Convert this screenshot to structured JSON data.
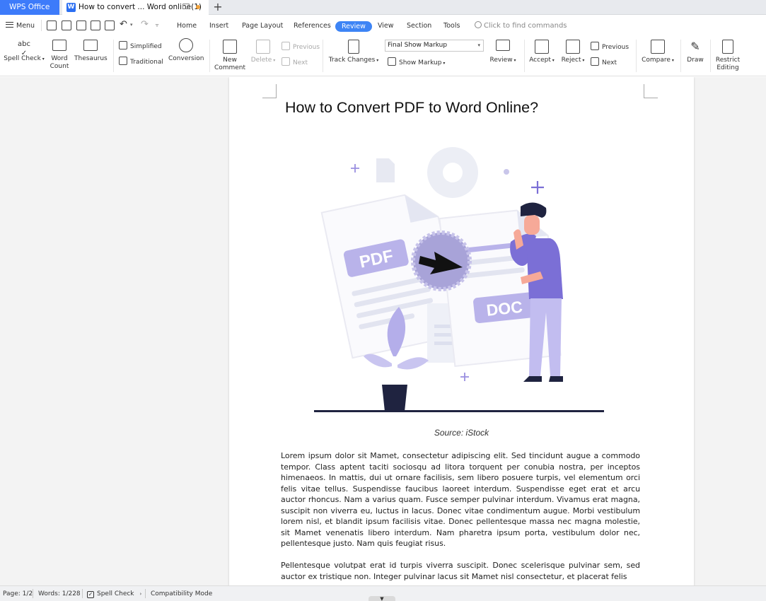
{
  "titlebar": {
    "brand": "WPS Office",
    "doc_tab_title": "How to convert ... Word online(1)",
    "new_tab": "+"
  },
  "menubar": {
    "menu_label": "Menu",
    "tabs": [
      "Home",
      "Insert",
      "Page Layout",
      "References",
      "Review",
      "View",
      "Section",
      "Tools"
    ],
    "active_tab": "Review",
    "search_placeholder": "Click to find commands"
  },
  "ribbon": {
    "spell_check": "Spell Check",
    "word_count_1": "Word",
    "word_count_2": "Count",
    "thesaurus": "Thesaurus",
    "simplified": "Simplified",
    "traditional": "Traditional",
    "conversion": "Conversion",
    "new_comment_1": "New",
    "new_comment_2": "Comment",
    "delete": "Delete",
    "previous_comment": "Previous",
    "next_comment": "Next",
    "track_changes": "Track Changes",
    "markup_select": "Final Show Markup",
    "show_markup": "Show Markup",
    "review": "Review",
    "accept": "Accept",
    "reject": "Reject",
    "previous_change": "Previous",
    "next_change": "Next",
    "compare": "Compare",
    "draw": "Draw",
    "restrict_1": "Restrict",
    "restrict_2": "Editing"
  },
  "document": {
    "title": "How to Convert PDF to Word Online?",
    "illustration": {
      "pdf_label": "PDF",
      "doc_label": "DOC"
    },
    "caption": "Source: iStock",
    "paragraph1": "Lorem ipsum dolor sit Mamet, consectetur adipiscing elit. Sed tincidunt augue a commodo tempor. Class aptent taciti sociosqu ad litora torquent per conubia nostra, per inceptos himenaeos. In mattis, dui ut ornare facilisis, sem libero posuere turpis, vel elementum orci felis vitae tellus. Suspendisse faucibus laoreet interdum. Suspendisse eget erat et arcu auctor rhoncus. Nam a varius quam. Fusce semper pulvinar interdum. Vivamus erat magna, suscipit non viverra eu, luctus in lacus. Donec vitae condimentum augue. Morbi vestibulum lorem nisl, et blandit ipsum facilisis vitae. Donec pellentesque massa nec magna molestie, sit Mamet venenatis libero interdum. Nam pharetra ipsum porta, vestibulum dolor nec, pellentesque justo. Nam quis feugiat risus.",
    "paragraph2": "Pellentesque volutpat erat id turpis viverra suscipit. Donec scelerisque pulvinar sem, sed auctor ex tristique non. Integer pulvinar lacus sit Mamet nisl consectetur, et placerat felis"
  },
  "statusbar": {
    "page": "Page: 1/2",
    "words": "Words: 1/228",
    "spell_check": "Spell Check",
    "compat": "Compatibility Mode"
  },
  "colors": {
    "accent": "#3d84f5",
    "brand": "#3d7bfa",
    "illustration_purple": "#7b6fd6"
  }
}
